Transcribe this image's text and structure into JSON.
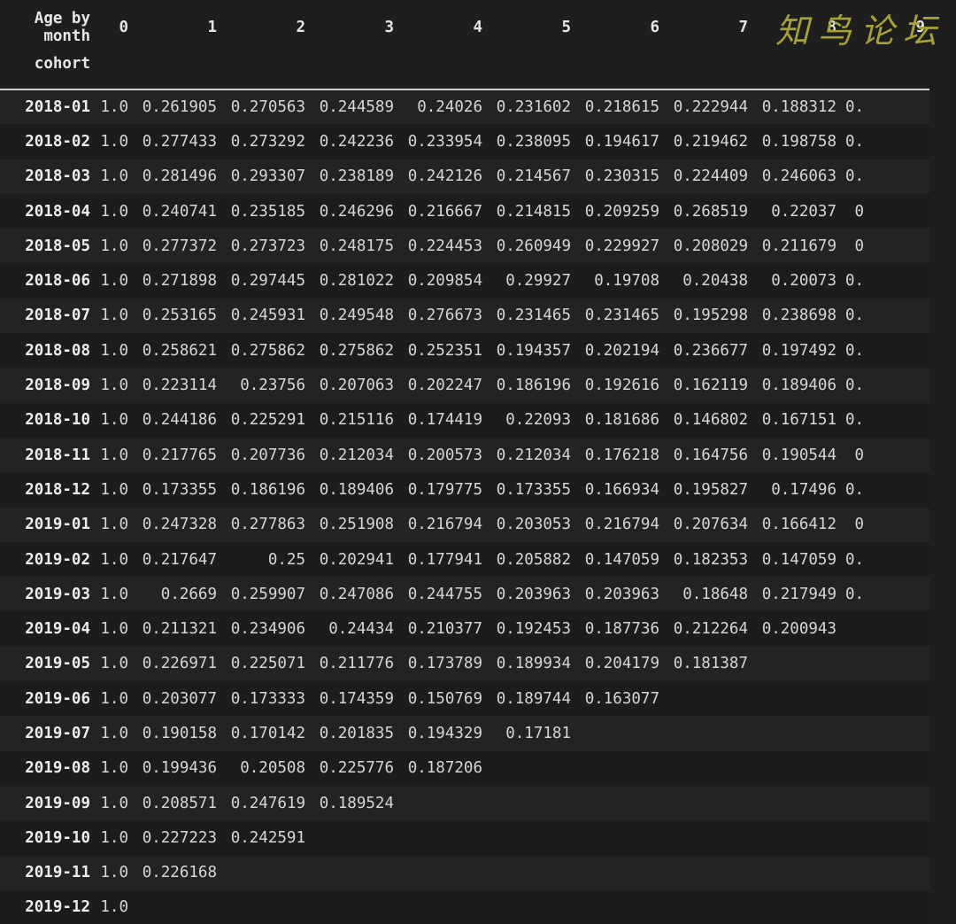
{
  "table": {
    "index_header_top": "Age by month",
    "index_header_bottom": "cohort",
    "columns": [
      "0",
      "1",
      "2",
      "3",
      "4",
      "5",
      "6",
      "7",
      "8",
      "9"
    ],
    "rows": [
      {
        "cohort": "2018-01",
        "values": [
          "1.0",
          "0.261905",
          "0.270563",
          "0.244589",
          "0.24026",
          "0.231602",
          "0.218615",
          "0.222944",
          "0.188312",
          "0."
        ]
      },
      {
        "cohort": "2018-02",
        "values": [
          "1.0",
          "0.277433",
          "0.273292",
          "0.242236",
          "0.233954",
          "0.238095",
          "0.194617",
          "0.219462",
          "0.198758",
          "0."
        ]
      },
      {
        "cohort": "2018-03",
        "values": [
          "1.0",
          "0.281496",
          "0.293307",
          "0.238189",
          "0.242126",
          "0.214567",
          "0.230315",
          "0.224409",
          "0.246063",
          "0."
        ]
      },
      {
        "cohort": "2018-04",
        "values": [
          "1.0",
          "0.240741",
          "0.235185",
          "0.246296",
          "0.216667",
          "0.214815",
          "0.209259",
          "0.268519",
          "0.22037",
          " 0"
        ]
      },
      {
        "cohort": "2018-05",
        "values": [
          "1.0",
          "0.277372",
          "0.273723",
          "0.248175",
          "0.224453",
          "0.260949",
          "0.229927",
          "0.208029",
          "0.211679",
          " 0"
        ]
      },
      {
        "cohort": "2018-06",
        "values": [
          "1.0",
          "0.271898",
          "0.297445",
          "0.281022",
          "0.209854",
          "0.29927",
          "0.19708",
          "0.20438",
          "0.20073",
          "0."
        ]
      },
      {
        "cohort": "2018-07",
        "values": [
          "1.0",
          "0.253165",
          "0.245931",
          "0.249548",
          "0.276673",
          "0.231465",
          "0.231465",
          "0.195298",
          "0.238698",
          "0."
        ]
      },
      {
        "cohort": "2018-08",
        "values": [
          "1.0",
          "0.258621",
          "0.275862",
          "0.275862",
          "0.252351",
          "0.194357",
          "0.202194",
          "0.236677",
          "0.197492",
          "0."
        ]
      },
      {
        "cohort": "2018-09",
        "values": [
          "1.0",
          "0.223114",
          "0.23756",
          "0.207063",
          "0.202247",
          "0.186196",
          "0.192616",
          "0.162119",
          "0.189406",
          "0."
        ]
      },
      {
        "cohort": "2018-10",
        "values": [
          "1.0",
          "0.244186",
          "0.225291",
          "0.215116",
          "0.174419",
          "0.22093",
          "0.181686",
          "0.146802",
          "0.167151",
          "0."
        ]
      },
      {
        "cohort": "2018-11",
        "values": [
          "1.0",
          "0.217765",
          "0.207736",
          "0.212034",
          "0.200573",
          "0.212034",
          "0.176218",
          "0.164756",
          "0.190544",
          " 0"
        ]
      },
      {
        "cohort": "2018-12",
        "values": [
          "1.0",
          "0.173355",
          "0.186196",
          "0.189406",
          "0.179775",
          "0.173355",
          "0.166934",
          "0.195827",
          "0.17496",
          "0."
        ]
      },
      {
        "cohort": "2019-01",
        "values": [
          "1.0",
          "0.247328",
          "0.277863",
          "0.251908",
          "0.216794",
          "0.203053",
          "0.216794",
          "0.207634",
          "0.166412",
          " 0"
        ]
      },
      {
        "cohort": "2019-02",
        "values": [
          "1.0",
          "0.217647",
          "0.25",
          "0.202941",
          "0.177941",
          "0.205882",
          "0.147059",
          "0.182353",
          "0.147059",
          "0."
        ]
      },
      {
        "cohort": "2019-03",
        "values": [
          "1.0",
          "0.2669",
          "0.259907",
          "0.247086",
          "0.244755",
          "0.203963",
          "0.203963",
          "0.18648",
          "0.217949",
          "0."
        ]
      },
      {
        "cohort": "2019-04",
        "values": [
          "1.0",
          "0.211321",
          "0.234906",
          "0.24434",
          "0.210377",
          "0.192453",
          "0.187736",
          "0.212264",
          "0.200943",
          ""
        ]
      },
      {
        "cohort": "2019-05",
        "values": [
          "1.0",
          "0.226971",
          "0.225071",
          "0.211776",
          "0.173789",
          "0.189934",
          "0.204179",
          "0.181387",
          "",
          ""
        ]
      },
      {
        "cohort": "2019-06",
        "values": [
          "1.0",
          "0.203077",
          "0.173333",
          "0.174359",
          "0.150769",
          "0.189744",
          "0.163077",
          "",
          "",
          ""
        ]
      },
      {
        "cohort": "2019-07",
        "values": [
          "1.0",
          "0.190158",
          "0.170142",
          "0.201835",
          "0.194329",
          "0.17181",
          "",
          "",
          "",
          ""
        ]
      },
      {
        "cohort": "2019-08",
        "values": [
          "1.0",
          "0.199436",
          "0.20508",
          "0.225776",
          "0.187206",
          "",
          "",
          "",
          "",
          ""
        ]
      },
      {
        "cohort": "2019-09",
        "values": [
          "1.0",
          "0.208571",
          "0.247619",
          "0.189524",
          "",
          "",
          "",
          "",
          "",
          ""
        ]
      },
      {
        "cohort": "2019-10",
        "values": [
          "1.0",
          "0.227223",
          "0.242591",
          "",
          "",
          "",
          "",
          "",
          "",
          ""
        ]
      },
      {
        "cohort": "2019-11",
        "values": [
          "1.0",
          "0.226168",
          "",
          "",
          "",
          "",
          "",
          "",
          "",
          ""
        ]
      },
      {
        "cohort": "2019-12",
        "values": [
          "1.0",
          "",
          "",
          "",
          "",
          "",
          "",
          "",
          "",
          ""
        ]
      }
    ]
  },
  "watermark": {
    "text": "知鸟论坛",
    "color": "#a6a23a"
  },
  "colors": {
    "background": "#1e1e1e",
    "row_odd": "#232323",
    "row_even": "#1c1c1c",
    "text": "#d6d6d6",
    "header_rule": "#d0d0d0"
  }
}
